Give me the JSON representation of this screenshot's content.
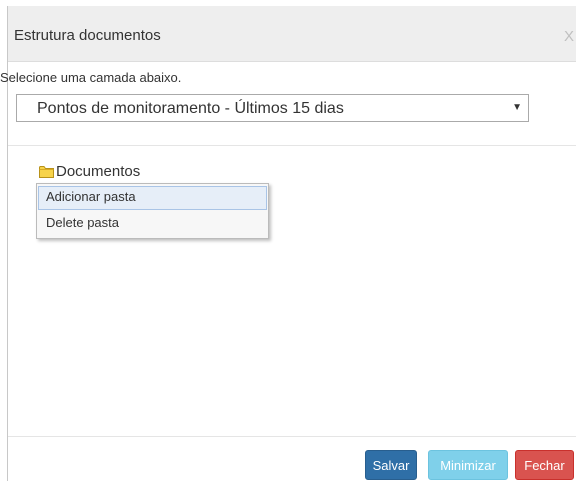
{
  "dialog": {
    "title": "Estrutura documentos",
    "close_label": "X"
  },
  "layer_select": {
    "label": "Selecione uma camada abaixo.",
    "selected_value": "Pontos de monitoramento - Últimos 15 dias",
    "arrow_icon": "dropdown-arrow-icon"
  },
  "tree": {
    "root_label": "Documentos",
    "root_icon": "folder-icon"
  },
  "context_menu": {
    "items": [
      {
        "label": "Adicionar pasta",
        "highlighted": true
      },
      {
        "label": "Delete pasta",
        "highlighted": false
      }
    ]
  },
  "footer": {
    "save_label": "Salvar",
    "minimize_label": "Minimizar",
    "close_label": "Fechar"
  },
  "colors": {
    "title_bar_bg": "#eeeeee",
    "save_button": "#2f6fa7",
    "minimize_button": "#7fd0ea",
    "close_button": "#d9534f",
    "folder_icon": "#f0c419",
    "menu_highlight": "#e6eef8"
  }
}
